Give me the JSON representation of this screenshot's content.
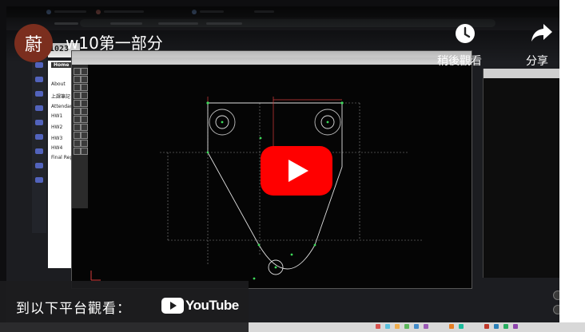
{
  "video": {
    "channel_avatar_char": "蔚",
    "title": "w10第一部分",
    "watch_later_label": "稍後觀看",
    "share_label": "分享",
    "watch_on_label": "到以下平台觀看：",
    "youtube_logo_text": "YouTube",
    "accent_red": "#ff0000"
  },
  "background_page": {
    "site_title": "1023",
    "sidebar_button": "Home",
    "sidebar_items": [
      "About",
      "上課筆記",
      "Attendance",
      "HW1",
      "HW2",
      "HW3",
      "HW4",
      "Final Repo..."
    ]
  },
  "icons": {
    "watch_later": "clock-icon",
    "share": "share-arrow-icon",
    "play": "youtube-play-icon"
  }
}
